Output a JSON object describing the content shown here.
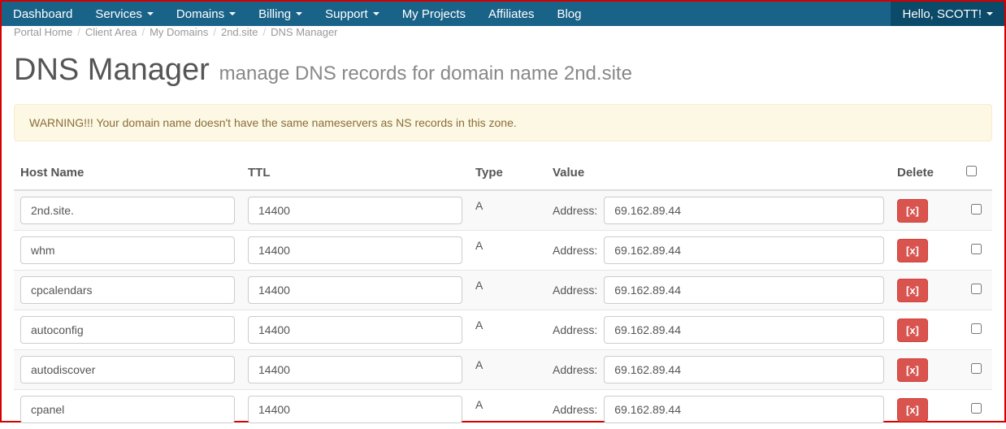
{
  "nav": {
    "items": [
      {
        "label": "Dashboard",
        "dropdown": false
      },
      {
        "label": "Services",
        "dropdown": true
      },
      {
        "label": "Domains",
        "dropdown": true
      },
      {
        "label": "Billing",
        "dropdown": true
      },
      {
        "label": "Support",
        "dropdown": true
      },
      {
        "label": "My Projects",
        "dropdown": false
      },
      {
        "label": "Affiliates",
        "dropdown": false
      },
      {
        "label": "Blog",
        "dropdown": false
      }
    ],
    "user_label": "Hello, SCOTT!"
  },
  "breadcrumb": {
    "items": [
      "Portal Home",
      "Client Area",
      "My Domains",
      "2nd.site",
      "DNS Manager"
    ]
  },
  "page": {
    "title": "DNS Manager",
    "subtitle": "manage DNS records for domain name 2nd.site"
  },
  "alert": {
    "text": "WARNING!!! Your domain name doesn't have the same nameservers as NS records in this zone."
  },
  "table": {
    "headers": {
      "host": "Host Name",
      "ttl": "TTL",
      "type": "Type",
      "value": "Value",
      "delete": "Delete"
    },
    "value_label": "Address:",
    "delete_btn": "[x]",
    "rows": [
      {
        "host": "2nd.site.",
        "ttl": "14400",
        "type": "A",
        "address": "69.162.89.44"
      },
      {
        "host": "whm",
        "ttl": "14400",
        "type": "A",
        "address": "69.162.89.44"
      },
      {
        "host": "cpcalendars",
        "ttl": "14400",
        "type": "A",
        "address": "69.162.89.44"
      },
      {
        "host": "autoconfig",
        "ttl": "14400",
        "type": "A",
        "address": "69.162.89.44"
      },
      {
        "host": "autodiscover",
        "ttl": "14400",
        "type": "A",
        "address": "69.162.89.44"
      },
      {
        "host": "cpanel",
        "ttl": "14400",
        "type": "A",
        "address": "69.162.89.44"
      }
    ]
  }
}
